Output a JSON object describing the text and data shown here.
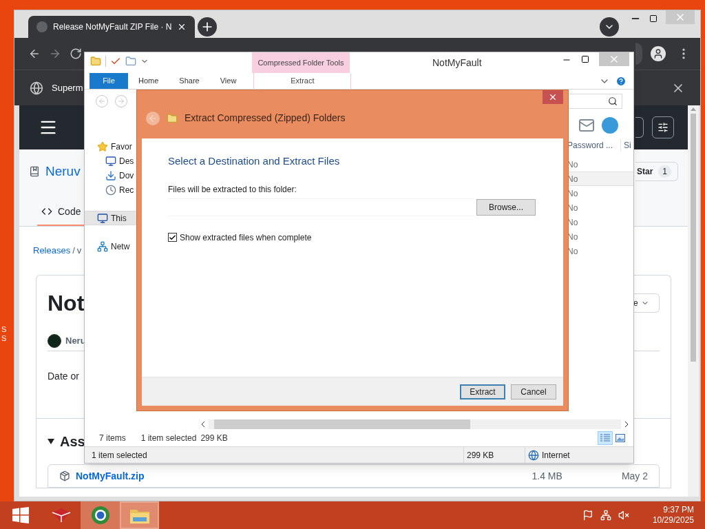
{
  "desktop": {
    "icon_label_fragments": [
      "S",
      "S"
    ]
  },
  "browser": {
    "tab_title": "Release NotMyFault ZIP File · N",
    "banner_text": "Superm",
    "page": {
      "repo_name": "Neruv",
      "star_label": "Star",
      "star_count": "1",
      "code_tab": "Code",
      "breadcrumb_link": "Releases",
      "breadcrumb_separator": "/",
      "breadcrumb_rest": "v",
      "release_title": "Not",
      "author": "Neru",
      "date_text": "Date or",
      "dropdown_text": "e",
      "assets_heading": "Ass",
      "asset": {
        "name": "NotMyFault.zip",
        "size": "1.4 MB",
        "date": "May 2"
      }
    }
  },
  "explorer": {
    "title": "NotMyFault",
    "contextual_group": "Compressed Folder Tools",
    "ribbon_tabs": [
      {
        "label": "File",
        "kind": "file"
      },
      {
        "label": "Home",
        "kind": "normal"
      },
      {
        "label": "Share",
        "kind": "normal"
      },
      {
        "label": "View",
        "kind": "normal"
      },
      {
        "label": "Extract",
        "kind": "contextual"
      }
    ],
    "nav_items": [
      {
        "label": "Favor",
        "selected": false,
        "children": [
          {
            "label": "Des",
            "selected": false
          },
          {
            "label": "Dov",
            "selected": false
          },
          {
            "label": "Rec",
            "selected": false
          }
        ]
      },
      {
        "label": "This",
        "selected": true
      },
      {
        "label": "Netw",
        "selected": false
      }
    ],
    "columns": [
      {
        "label": "Password ..."
      },
      {
        "label": "Si"
      }
    ],
    "rows": [
      {
        "password": "No",
        "selected": false
      },
      {
        "password": "No",
        "selected": true
      },
      {
        "password": "No",
        "selected": false
      },
      {
        "password": "No",
        "selected": false
      },
      {
        "password": "No",
        "selected": false
      },
      {
        "password": "No",
        "selected": false
      },
      {
        "password": "No",
        "selected": false
      }
    ],
    "item_count": "7 items",
    "selection_info": "1 item selected",
    "selection_size": "299 KB",
    "views": [
      {
        "kind": "details",
        "selected": true
      },
      {
        "kind": "large-icons",
        "selected": false
      }
    ],
    "status_bar": {
      "selection": "1 item selected",
      "size": "299 KB",
      "zone": "Internet"
    }
  },
  "dialog": {
    "title": "Extract Compressed (Zipped) Folders",
    "heading": "Select a Destination and Extract Files",
    "path_label": "Files will be extracted to this folder:",
    "browse_label": "Browse...",
    "show_files": {
      "label": "Show extracted files when complete",
      "checked": true
    },
    "buttons": [
      {
        "label": "Extract",
        "default": true
      },
      {
        "label": "Cancel",
        "default": false
      }
    ]
  },
  "taskbar": {
    "apps": [
      {
        "kind": "toolbox",
        "open": false,
        "selected": false
      },
      {
        "kind": "browser",
        "open": true,
        "selected": false
      },
      {
        "kind": "explorer",
        "open": true,
        "selected": true
      }
    ],
    "time": "9:37 PM",
    "date": "10/29/2025"
  }
}
